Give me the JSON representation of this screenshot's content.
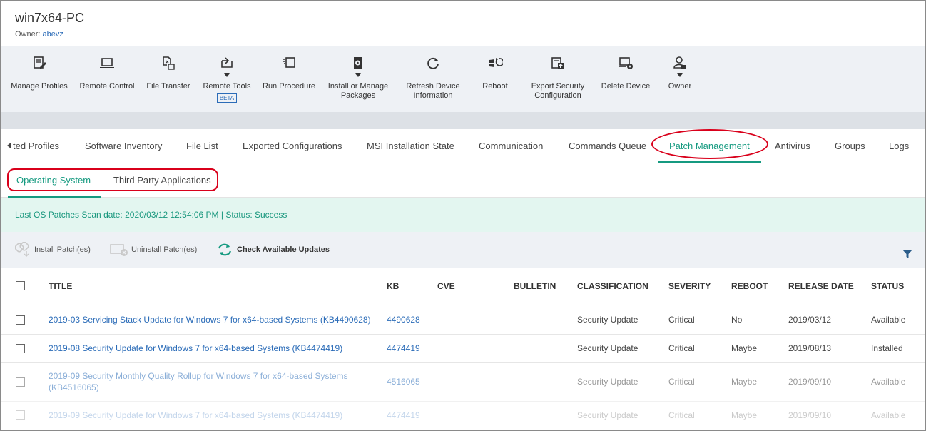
{
  "device": {
    "title": "win7x64-PC",
    "owner_label": "Owner:",
    "owner_name": "abevz"
  },
  "toolbar": {
    "items": [
      {
        "label": "Manage Profiles",
        "icon": "edit-profile-icon"
      },
      {
        "label": "Remote Control",
        "icon": "laptop-icon"
      },
      {
        "label": "File Transfer",
        "icon": "file-transfer-icon"
      },
      {
        "label": "Remote Tools",
        "icon": "remote-tools-icon",
        "badge": "BETA",
        "dropdown": true
      },
      {
        "label": "Run Procedure",
        "icon": "run-procedure-icon"
      },
      {
        "label_line1": "Install or Manage",
        "label_line2": "Packages",
        "icon": "package-icon",
        "dropdown": true
      },
      {
        "label_line1": "Refresh Device",
        "label_line2": "Information",
        "icon": "refresh-icon"
      },
      {
        "label": "Reboot",
        "icon": "reboot-icon"
      },
      {
        "label_line1": "Export Security",
        "label_line2": "Configuration",
        "icon": "export-icon"
      },
      {
        "label": "Delete Device",
        "icon": "delete-device-icon"
      },
      {
        "label": "Owner",
        "icon": "owner-icon",
        "dropdown": true
      }
    ]
  },
  "tabs": {
    "items": [
      "ted Profiles",
      "Software Inventory",
      "File List",
      "Exported Configurations",
      "MSI Installation State",
      "Communication",
      "Commands Queue",
      "Patch Management",
      "Antivirus",
      "Groups",
      "Logs"
    ],
    "active": "Patch Management"
  },
  "subtabs": {
    "items": [
      "Operating System",
      "Third Party Applications"
    ],
    "active": "Operating System"
  },
  "scan": {
    "text": "Last OS Patches Scan date: 2020/03/12 12:54:06 PM | Status: Success"
  },
  "actions": {
    "install": "Install Patch(es)",
    "uninstall": "Uninstall Patch(es)",
    "check": "Check Available Updates"
  },
  "table": {
    "columns": [
      "TITLE",
      "KB",
      "CVE",
      "BULLETIN",
      "CLASSIFICATION",
      "SEVERITY",
      "REBOOT",
      "RELEASE DATE",
      "STATUS"
    ],
    "rows": [
      {
        "title": "2019-03 Servicing Stack Update for Windows 7 for x64-based Systems (KB4490628)",
        "kb": "4490628",
        "cve": "",
        "bulletin": "",
        "classification": "Security Update",
        "severity": "Critical",
        "reboot": "No",
        "release_date": "2019/03/12",
        "status": "Available"
      },
      {
        "title": "2019-08 Security Update for Windows 7 for x64-based Systems (KB4474419)",
        "kb": "4474419",
        "cve": "",
        "bulletin": "",
        "classification": "Security Update",
        "severity": "Critical",
        "reboot": "Maybe",
        "release_date": "2019/08/13",
        "status": "Installed"
      },
      {
        "title_line1": "2019-09 Security Monthly Quality Rollup for Windows 7 for x64-based Systems",
        "title_line2": "(KB4516065)",
        "kb": "4516065",
        "cve": "",
        "bulletin": "",
        "classification": "Security Update",
        "severity": "Critical",
        "reboot": "Maybe",
        "release_date": "2019/09/10",
        "status": "Available"
      },
      {
        "title": "2019-09 Security Update for Windows 7 for x64-based Systems (KB4474419)",
        "kb": "4474419",
        "cve": "",
        "bulletin": "",
        "classification": "Security Update",
        "severity": "Critical",
        "reboot": "Maybe",
        "release_date": "2019/09/10",
        "status": "Available"
      }
    ]
  },
  "colors": {
    "accent": "#159a80",
    "link": "#2b6cb8",
    "annotation": "#d9001b",
    "scan_bg": "#e3f6f0",
    "toolbar_bg": "#eef1f5"
  }
}
